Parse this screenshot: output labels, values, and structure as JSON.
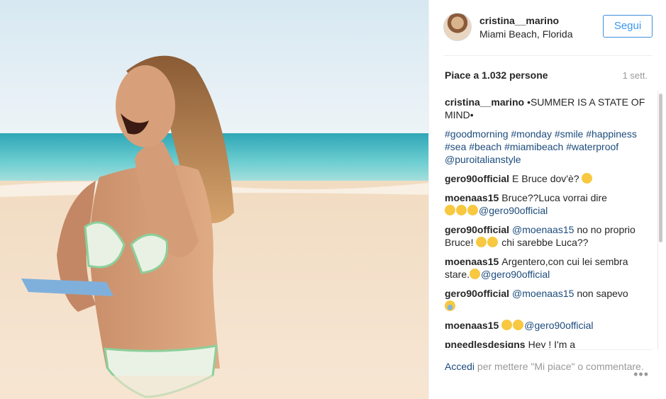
{
  "post": {
    "username": "cristina__marino",
    "location": "Miami Beach, Florida",
    "follow_label": "Segui",
    "likes_text": "Piace a 1.032 persone",
    "time_ago": "1 sett."
  },
  "caption": {
    "user": "cristina__marino",
    "text": "•SUMMER IS A STATE OF MIND•",
    "hashtags": "#goodmorning #monday #smile #happiness #sea #beach #miamibeach #waterproof @puroitalianstyle"
  },
  "comments": [
    {
      "user": "gero90official",
      "text": "E Bruce dov'è?"
    },
    {
      "user": "moenaas15",
      "text": "Bruce??Luca vorrai dire",
      "mention": "@gero90official"
    },
    {
      "user": "gero90official",
      "mention": "@moenaas15",
      "text": "no no proprio Bruce!",
      "text2": "chi sarebbe Luca??"
    },
    {
      "user": "moenaas15",
      "text": "Argentero,con cui lei sembra stare.",
      "mention": "@gero90official"
    },
    {
      "user": "gero90official",
      "mention": "@moenaas15",
      "text": "non sapevo"
    },
    {
      "user": "moenaas15",
      "mention": "@gero90official"
    },
    {
      "user": "pneedlesdesigns",
      "text": "Hey ! I'm a"
    }
  ],
  "footer": {
    "login_label": "Accedi",
    "rest": "per mettere \"Mi piace\" o commentare.",
    "more_icon": "•••"
  },
  "icons": {
    "avatar": "avatar-photo",
    "more": "ellipsis-icon",
    "emoji": "laughing-emoji-icon"
  },
  "colors": {
    "link": "#1c4b7c",
    "follow_blue": "#3897f0",
    "muted": "#999999"
  }
}
